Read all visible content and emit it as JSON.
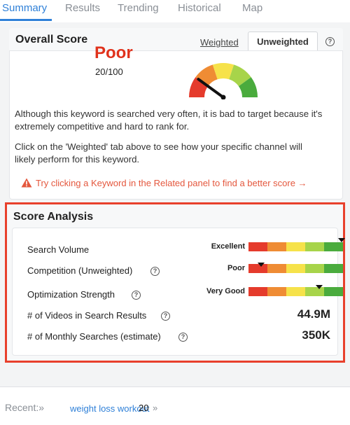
{
  "tabs": [
    {
      "label": "Summary"
    },
    {
      "label": "Results"
    },
    {
      "label": "Trending"
    },
    {
      "label": "Historical"
    },
    {
      "label": "Map"
    }
  ],
  "active_tab": "Summary",
  "overall": {
    "title": "Overall Score",
    "weighted_tab": "Weighted",
    "unweighted_tab": "Unweighted",
    "help_symbol": "?",
    "grade": "Poor",
    "score": "20/100",
    "gauge_level": 0.2,
    "paragraph1": "Although this keyword is searched very often, it is bad to target because it's extremely competitive and hard to rank for.",
    "paragraph2": "Click on the 'Weighted' tab above to see how your specific channel will likely perform for this keyword.",
    "hint": "Try clicking a Keyword in the Related panel to find a better score →"
  },
  "analysis": {
    "title": "Score Analysis",
    "rows": [
      {
        "label": "Search Volume",
        "rating": "Excellent",
        "level": 1.0
      },
      {
        "label": "Competition (Unweighted)",
        "rating": "Poor",
        "level": 0.13
      },
      {
        "label": "Optimization Strength",
        "rating": "Very Good",
        "level": 0.75
      }
    ],
    "stats": [
      {
        "label": "# of Videos in Search Results",
        "value": "44.9M"
      },
      {
        "label": "# of Monthly Searches (estimate)",
        "value": "350K"
      }
    ]
  },
  "colors": {
    "accent": "#2f80d8",
    "poor": "#e0321c",
    "highlight_border": "#e8402c",
    "scale": [
      "#e53b2c",
      "#ef8c34",
      "#f6e24a",
      "#a7d44a",
      "#4aab3d"
    ]
  },
  "recent": {
    "label": "Recent:»",
    "keyword": "weight loss workout",
    "count": "20",
    "more": "»"
  }
}
